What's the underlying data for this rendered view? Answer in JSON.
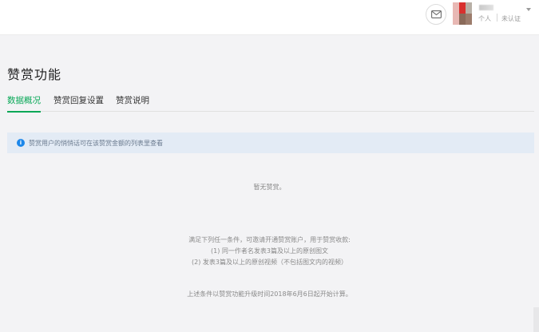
{
  "header": {
    "account_type": "个人",
    "verify_status": "未认证"
  },
  "page": {
    "title": "赞赏功能"
  },
  "tabs": [
    {
      "label": "数据概况",
      "active": true
    },
    {
      "label": "赞赏回复设置",
      "active": false
    },
    {
      "label": "赞赏说明",
      "active": false
    }
  ],
  "notice": {
    "icon": "info-icon",
    "text": "赞赏用户的悄悄话可在该赞赏金额的列表里查看"
  },
  "empty_state": {
    "text": "暂无赞赏。"
  },
  "conditions": {
    "intro": "满足下列任一条件，可邀请开通赞赏账户，用于赞赏收款:",
    "items": [
      "(1) 同一作者名发表3篇及以上的原创图文",
      "(2) 发表3篇及以上的原创视频（不包括图文内的视频）"
    ]
  },
  "footnote": "上述条件以赞赏功能升级时间2018年6月6日起开始计算。",
  "colors": {
    "accent": "#07a756",
    "notice_bg": "#e3ebf5",
    "info_icon": "#1c87ea"
  }
}
